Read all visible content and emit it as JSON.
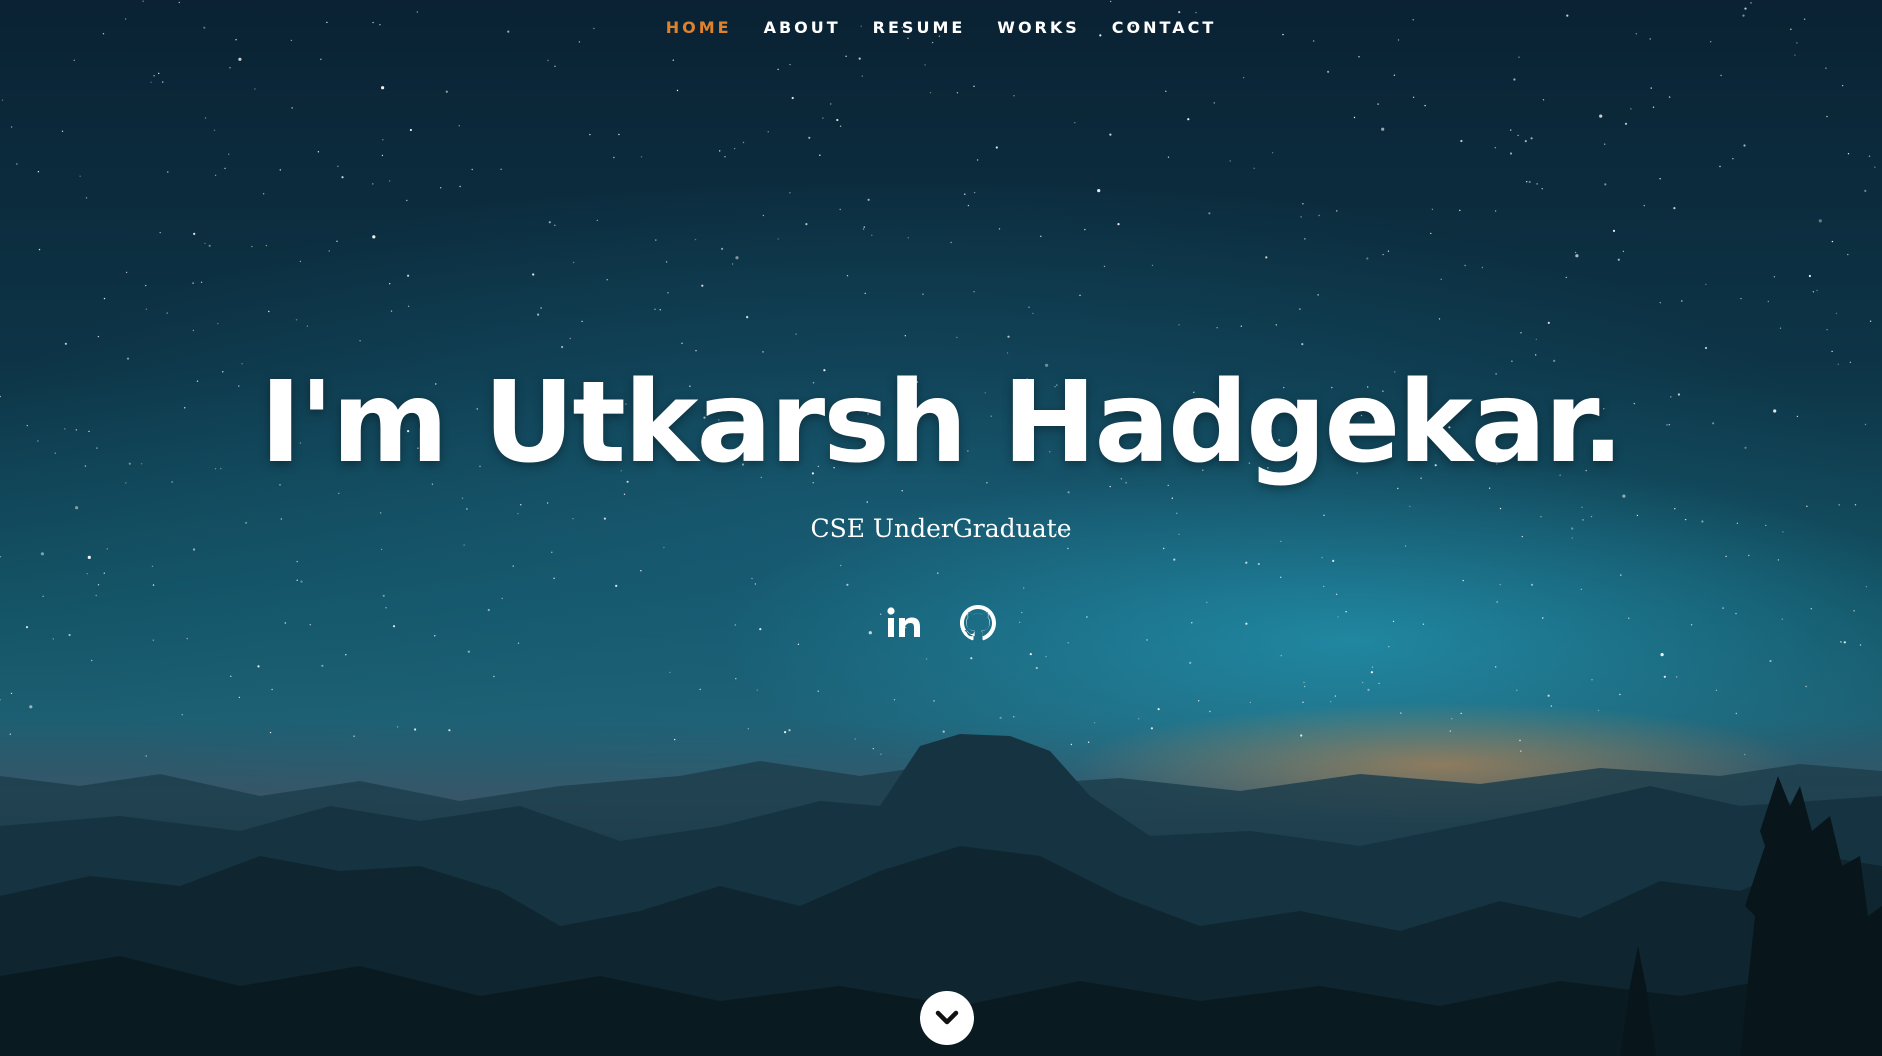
{
  "nav": {
    "items": [
      {
        "label": "HOME",
        "active": true
      },
      {
        "label": "ABOUT",
        "active": false
      },
      {
        "label": "RESUME",
        "active": false
      },
      {
        "label": "WORKS",
        "active": false
      },
      {
        "label": "CONTACT",
        "active": false
      }
    ],
    "active_color": "#e0822c"
  },
  "hero": {
    "headline": "I'm Utkarsh Hadgekar.",
    "subtitle": "CSE UnderGraduate"
  },
  "social": {
    "icons": [
      "linkedin-icon",
      "github-icon"
    ]
  },
  "scroll": {
    "icon": "chevron-down-icon"
  }
}
